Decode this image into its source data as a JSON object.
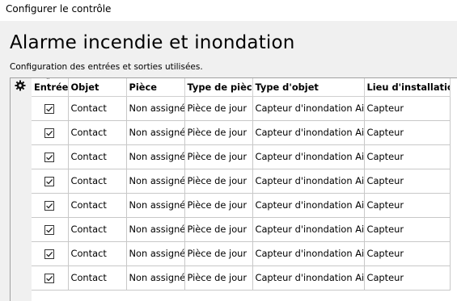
{
  "window": {
    "title": "Configurer le contrôle"
  },
  "page": {
    "heading": "Alarme incendie et inondation",
    "subheading": "Configuration des entrées et sorties utilisées."
  },
  "table": {
    "settings_icon": "gear-icon",
    "columns": {
      "entree": "Entrée",
      "objet": "Objet",
      "piece": "Pièce",
      "type_piece": "Type de pièce",
      "type_objet": "Type d'objet",
      "lieu": "Lieu d'installation"
    },
    "rows": [
      {
        "entree": true,
        "objet": "Contact",
        "piece": "Non assigné",
        "type_piece": "Pièce de jour",
        "type_objet": "Capteur d'inondation Air",
        "lieu": "Capteur"
      },
      {
        "entree": true,
        "objet": "Contact",
        "piece": "Non assigné",
        "type_piece": "Pièce de jour",
        "type_objet": "Capteur d'inondation Air",
        "lieu": "Capteur"
      },
      {
        "entree": true,
        "objet": "Contact",
        "piece": "Non assigné",
        "type_piece": "Pièce de jour",
        "type_objet": "Capteur d'inondation Air",
        "lieu": "Capteur"
      },
      {
        "entree": true,
        "objet": "Contact",
        "piece": "Non assigné",
        "type_piece": "Pièce de jour",
        "type_objet": "Capteur d'inondation Air",
        "lieu": "Capteur"
      },
      {
        "entree": true,
        "objet": "Contact",
        "piece": "Non assigné",
        "type_piece": "Pièce de jour",
        "type_objet": "Capteur d'inondation Air",
        "lieu": "Capteur"
      },
      {
        "entree": true,
        "objet": "Contact",
        "piece": "Non assigné",
        "type_piece": "Pièce de jour",
        "type_objet": "Capteur d'inondation Air",
        "lieu": "Capteur"
      },
      {
        "entree": true,
        "objet": "Contact",
        "piece": "Non assigné",
        "type_piece": "Pièce de jour",
        "type_objet": "Capteur d'inondation Air",
        "lieu": "Capteur"
      },
      {
        "entree": true,
        "objet": "Contact",
        "piece": "Non assigné",
        "type_piece": "Pièce de jour",
        "type_objet": "Capteur d'inondation Air",
        "lieu": "Capteur"
      }
    ]
  }
}
